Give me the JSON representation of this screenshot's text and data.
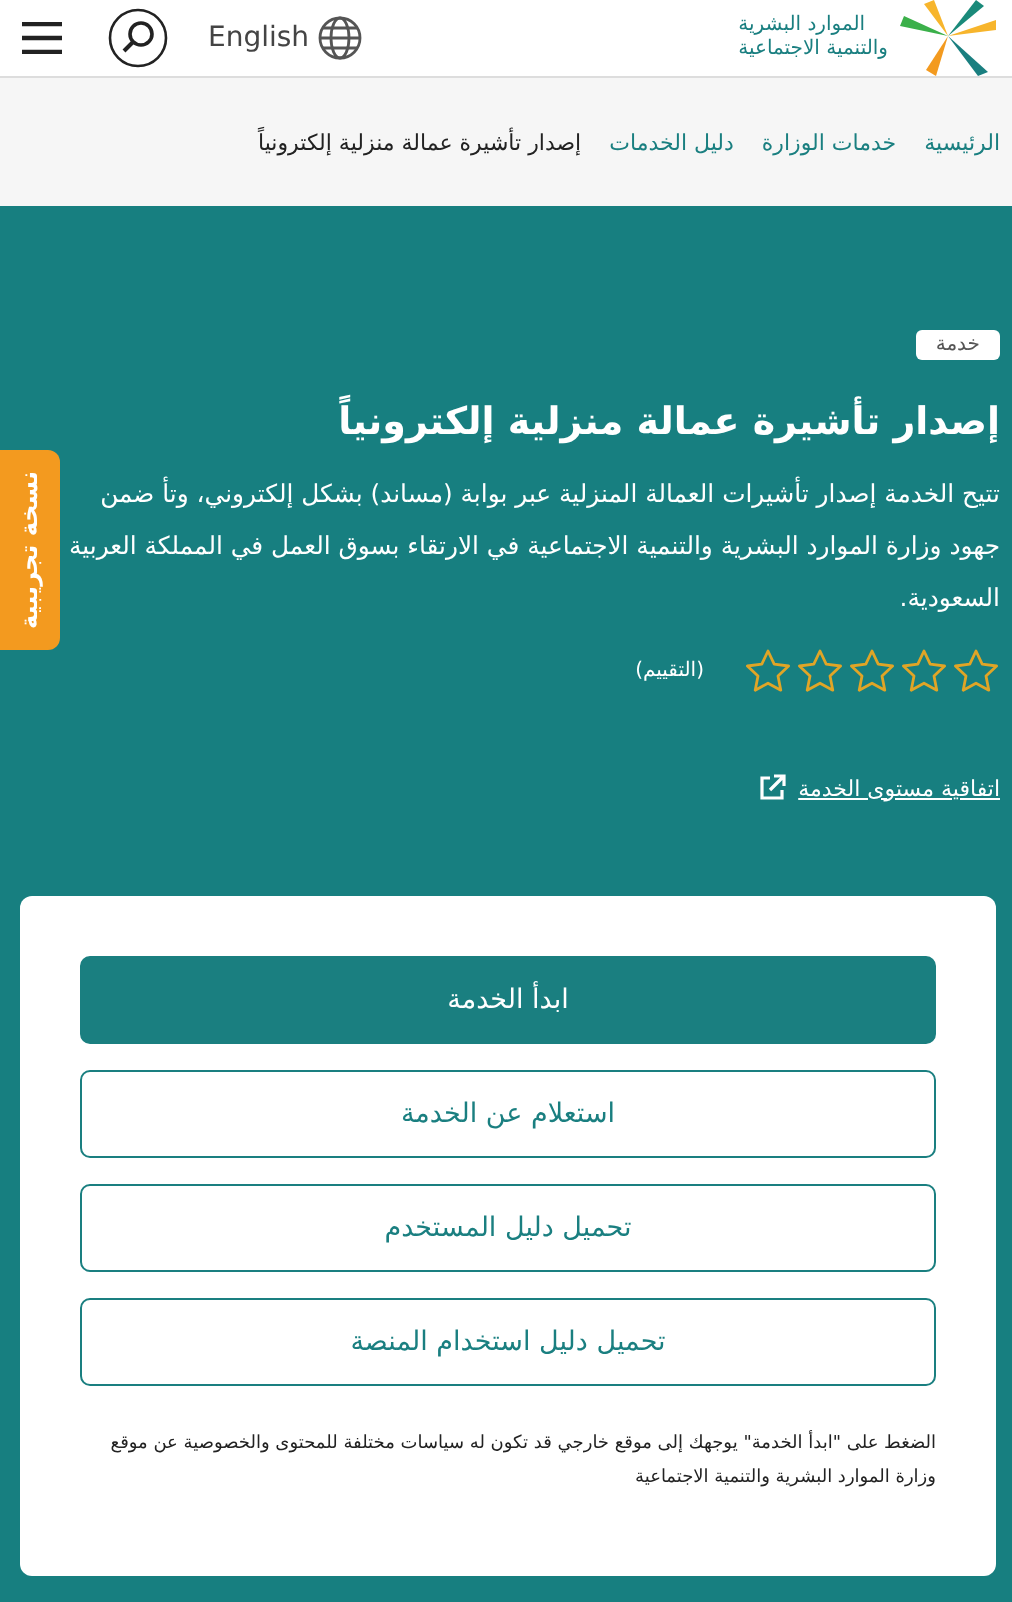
{
  "header": {
    "logo_lines": [
      "الموارد البشرية",
      "والتنمية الاجتماعية"
    ],
    "language": "English"
  },
  "breadcrumb": [
    {
      "label": "الرئيسية",
      "current": false
    },
    {
      "label": "خدمات الوزارة",
      "current": false
    },
    {
      "label": "دليل الخدمات",
      "current": false
    },
    {
      "label": "إصدار تأشيرة عمالة منزلية إلكترونياً",
      "current": true
    }
  ],
  "side_tab": "نسخة تجريبية",
  "service": {
    "badge": "خدمة",
    "title": "إصدار تأشيرة عمالة منزلية إلكترونياً",
    "description": "تتيح الخدمة إصدار تأشيرات العمالة المنزلية عبر بوابة (مساند) بشكل إلكتروني، وتأ ضمن جهود وزارة الموارد البشرية والتنمية الاجتماعية في الارتقاء بسوق العمل في المملكة العربية السعودية.",
    "stars": 0,
    "rating_label": "(التقييم)",
    "sla_link": "اتفاقية مستوى الخدمة"
  },
  "actions": [
    {
      "label": "ابدأ الخدمة",
      "primary": true
    },
    {
      "label": "استعلام عن الخدمة",
      "primary": false
    },
    {
      "label": "تحميل دليل المستخدم",
      "primary": false
    },
    {
      "label": "تحميل دليل استخدام المنصة",
      "primary": false
    }
  ],
  "note": "الضغط على \"ابدأ الخدمة\" يوجهك إلى موقع خارجي قد تكون له سياسات مختلفة للمحتوى والخصوصية عن موقع وزارة الموارد البشرية والتنمية الاجتماعية"
}
